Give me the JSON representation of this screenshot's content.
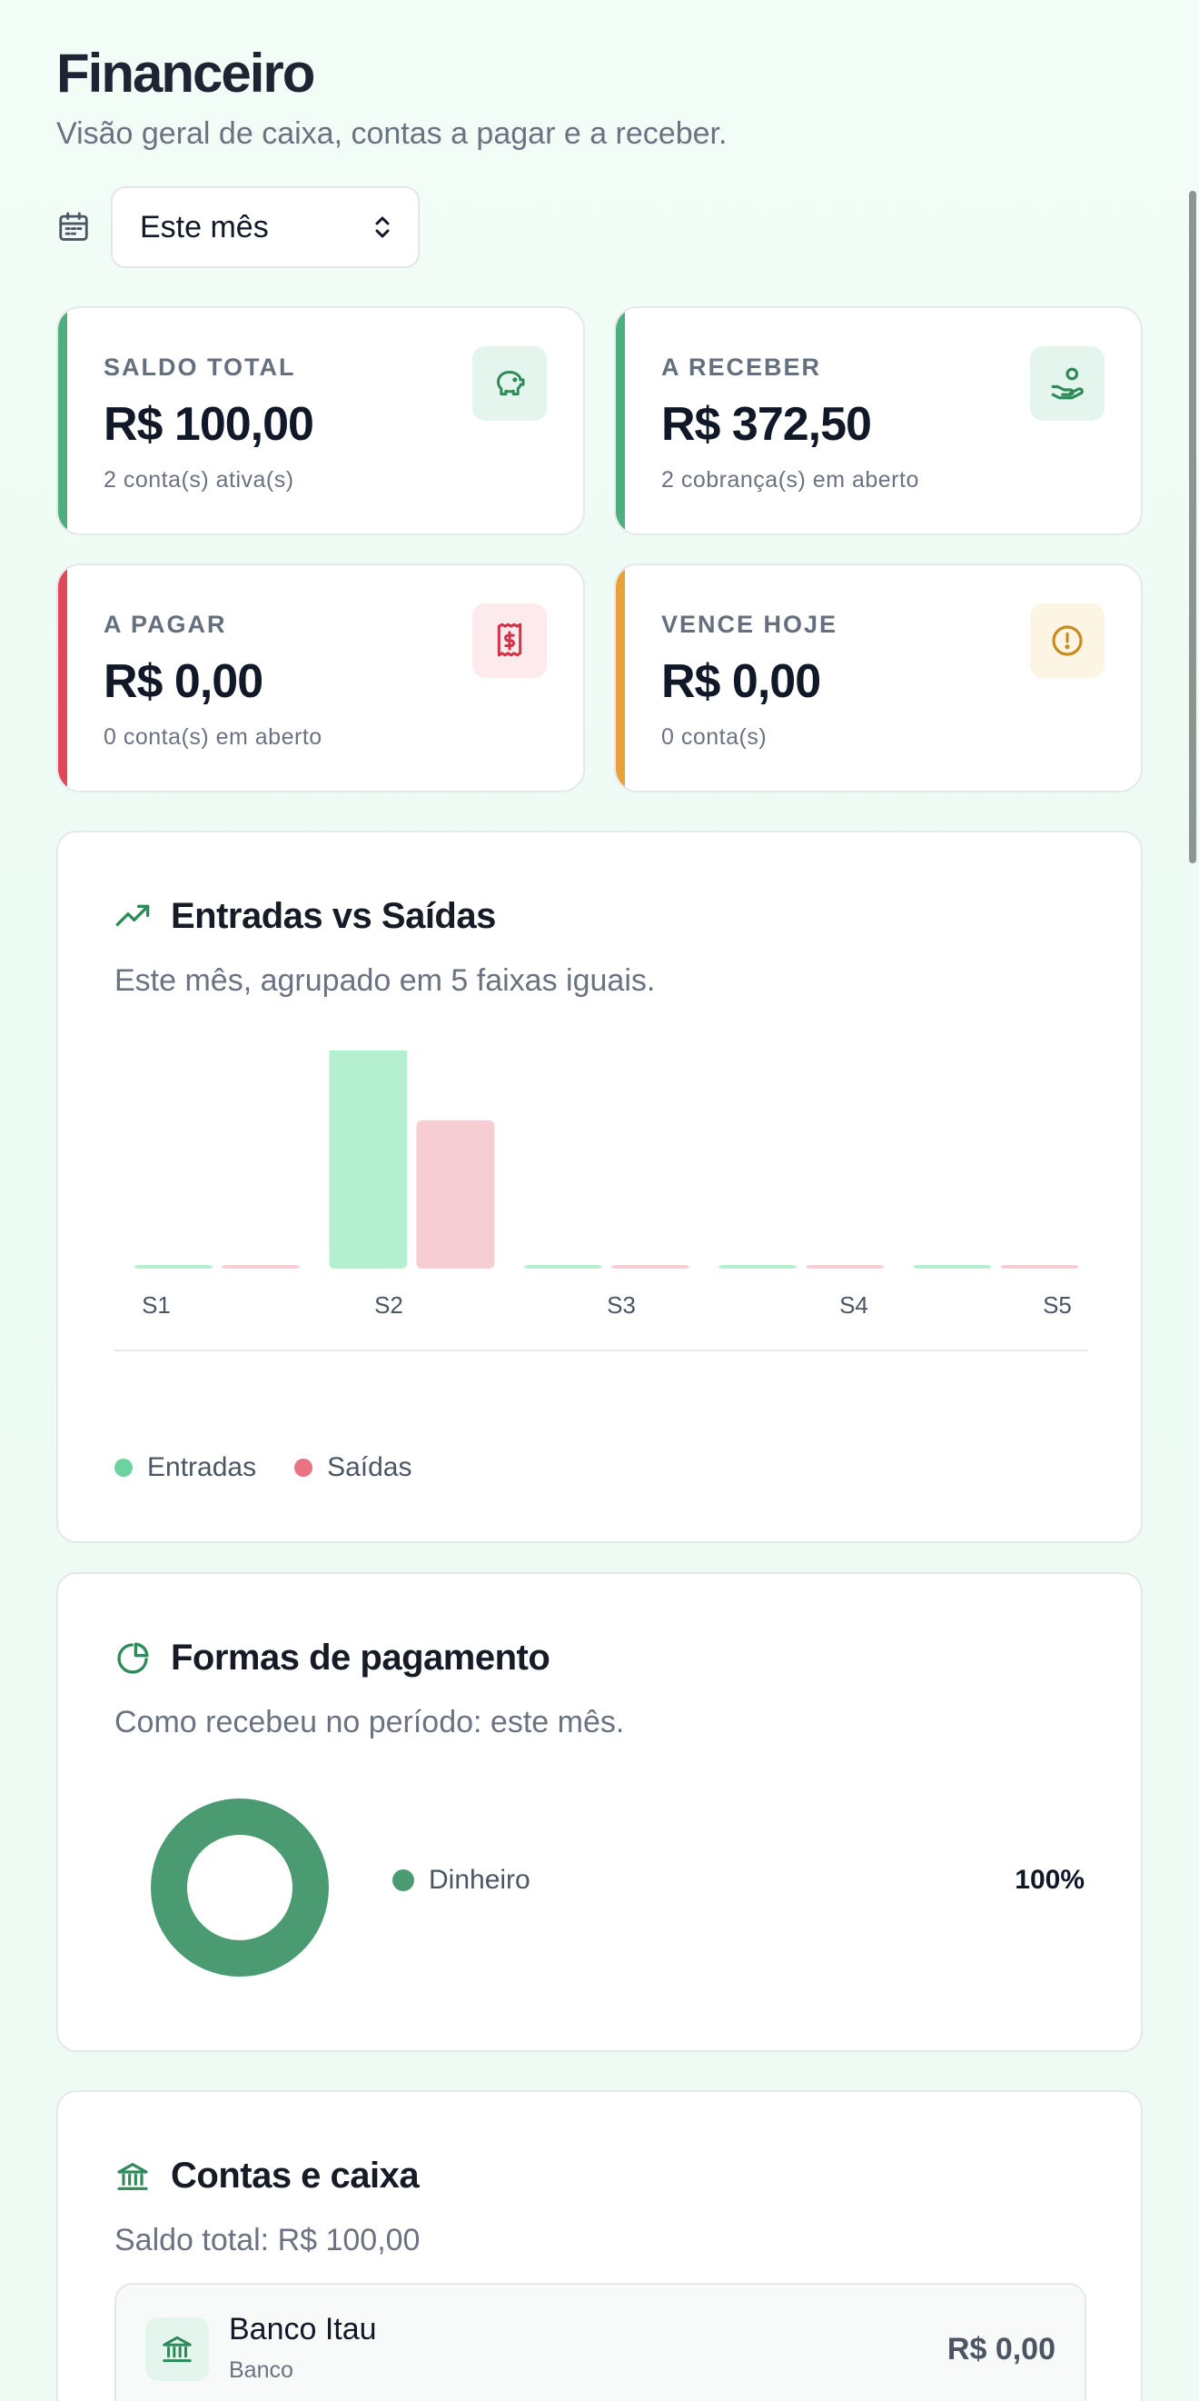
{
  "header": {
    "title": "Financeiro",
    "subtitle": "Visão geral de caixa, contas a pagar e a receber."
  },
  "filter": {
    "period_value": "Este mês",
    "calendar_icon": "calendar-icon",
    "chevron_icon": "chevron-up-down-icon"
  },
  "kpis": [
    {
      "label": "SALDO TOTAL",
      "value": "R$ 100,00",
      "sub": "2 conta(s) ativa(s)",
      "icon": "piggy-bank-icon",
      "accent": "#4caf7d",
      "icon_bg": "#e3f5ec",
      "icon_color": "#2f8a5a"
    },
    {
      "label": "A RECEBER",
      "value": "R$ 372,50",
      "sub": "2 cobrança(s) em aberto",
      "icon": "hand-coins-icon",
      "accent": "#4caf7d",
      "icon_bg": "#e3f5ec",
      "icon_color": "#2f8a5a"
    },
    {
      "label": "A PAGAR",
      "value": "R$ 0,00",
      "sub": "0 conta(s) em aberto",
      "icon": "receipt-icon",
      "accent": "#e0475b",
      "icon_bg": "#fdeaec",
      "icon_color": "#d0334a"
    },
    {
      "label": "VENCE HOJE",
      "value": "R$ 0,00",
      "sub": "0 conta(s)",
      "icon": "alert-circle-icon",
      "accent": "#e9a23b",
      "icon_bg": "#fdf5e3",
      "icon_color": "#c98a22"
    }
  ],
  "flow_card": {
    "title": "Entradas vs Saídas",
    "subtitle": "Este mês, agrupado em 5 faixas iguais.",
    "icon": "trending-up-icon"
  },
  "payment_card": {
    "title": "Formas de pagamento",
    "subtitle": "Como recebeu no período: este mês.",
    "icon": "pie-chart-icon",
    "items": [
      {
        "label": "Dinheiro",
        "percent": "100%",
        "color": "#4a9a72"
      }
    ]
  },
  "accounts_card": {
    "title": "Contas e caixa",
    "subtitle": "Saldo total: R$ 100,00",
    "icon": "bank-icon",
    "accounts": [
      {
        "name": "Banco Itau",
        "type": "Banco",
        "balance": "R$ 0,00",
        "icon": "bank-icon"
      }
    ]
  },
  "chart_data": [
    {
      "type": "bar",
      "categories": [
        "S1",
        "S2",
        "S3",
        "S4",
        "S5"
      ],
      "series": [
        {
          "name": "Entradas",
          "values": [
            0,
            372.5,
            0,
            0,
            0
          ],
          "color": "#b4f0cf"
        },
        {
          "name": "Saídas",
          "values": [
            0,
            200,
            0,
            0,
            0
          ],
          "color": "#f6cdd3"
        }
      ],
      "legend_colors": [
        "#6cd39f",
        "#ea7381"
      ],
      "ylim": [
        0,
        372.5
      ],
      "grid": false,
      "legend": "bottom-left"
    },
    {
      "type": "pie",
      "categories": [
        "Dinheiro"
      ],
      "values": [
        100
      ],
      "colors": [
        "#4a9a72"
      ],
      "donut": true
    }
  ]
}
